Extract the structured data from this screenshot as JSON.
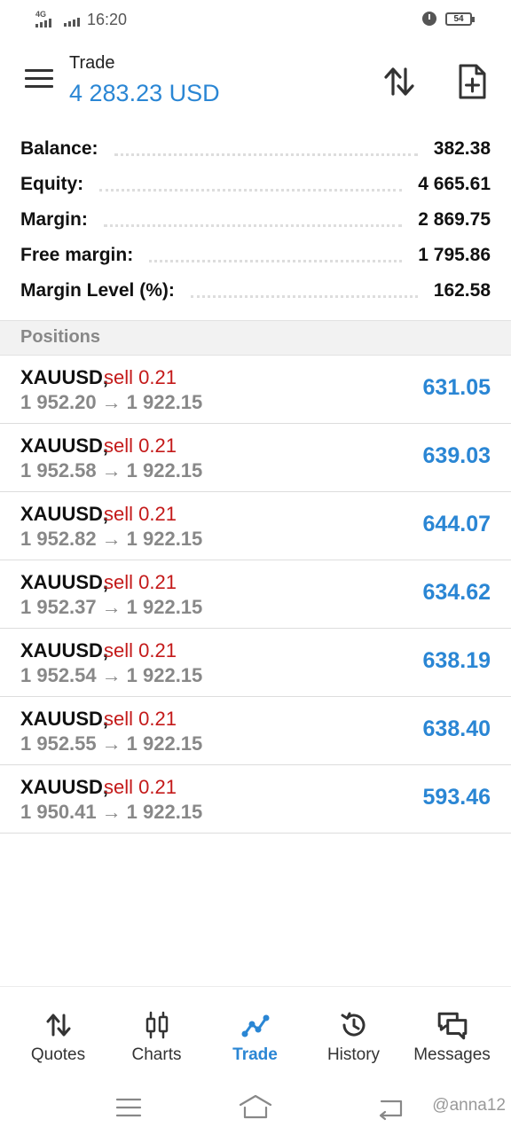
{
  "status_bar": {
    "network_tag": "4G",
    "time": "16:20",
    "battery": "54"
  },
  "header": {
    "title": "Trade",
    "amount": "4 283.23 USD"
  },
  "summary": [
    {
      "label": "Balance:",
      "value": "382.38"
    },
    {
      "label": "Equity:",
      "value": "4 665.61"
    },
    {
      "label": "Margin:",
      "value": "2 869.75"
    },
    {
      "label": "Free margin:",
      "value": "1 795.86"
    },
    {
      "label": "Margin Level (%):",
      "value": "162.58"
    }
  ],
  "positions_header": "Positions",
  "positions": [
    {
      "symbol": "XAUUSD,",
      "side": "sell 0.21",
      "open": "1 952.20",
      "arrow": "→",
      "current": "1 922.15",
      "profit": "631.05"
    },
    {
      "symbol": "XAUUSD,",
      "side": "sell 0.21",
      "open": "1 952.58",
      "arrow": "→",
      "current": "1 922.15",
      "profit": "639.03"
    },
    {
      "symbol": "XAUUSD,",
      "side": "sell 0.21",
      "open": "1 952.82",
      "arrow": "→",
      "current": "1 922.15",
      "profit": "644.07"
    },
    {
      "symbol": "XAUUSD,",
      "side": "sell 0.21",
      "open": "1 952.37",
      "arrow": "→",
      "current": "1 922.15",
      "profit": "634.62"
    },
    {
      "symbol": "XAUUSD,",
      "side": "sell 0.21",
      "open": "1 952.54",
      "arrow": "→",
      "current": "1 922.15",
      "profit": "638.19"
    },
    {
      "symbol": "XAUUSD,",
      "side": "sell 0.21",
      "open": "1 952.55",
      "arrow": "→",
      "current": "1 922.15",
      "profit": "638.40"
    },
    {
      "symbol": "XAUUSD,",
      "side": "sell 0.21",
      "open": "1 950.41",
      "arrow": "→",
      "current": "1 922.15",
      "profit": "593.46"
    }
  ],
  "bottom_nav": [
    {
      "label": "Quotes",
      "icon": "quotes-icon",
      "active": false
    },
    {
      "label": "Charts",
      "icon": "charts-icon",
      "active": false
    },
    {
      "label": "Trade",
      "icon": "trade-icon",
      "active": true
    },
    {
      "label": "History",
      "icon": "history-icon",
      "active": false
    },
    {
      "label": "Messages",
      "icon": "messages-icon",
      "active": false
    }
  ],
  "watermark": "@anna12",
  "colors": {
    "accent_blue": "#2a86d4",
    "sell_red": "#c41a1a",
    "muted_gray": "#888888"
  }
}
